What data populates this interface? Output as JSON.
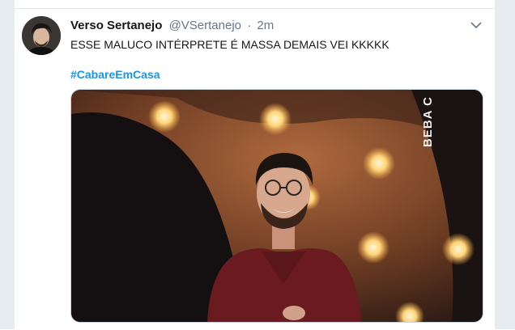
{
  "tweet": {
    "display_name": "Verso Sertanejo",
    "handle": "@VSertanejo",
    "separator": "·",
    "time": "2m",
    "text": "ESSE MALUCO INTÉRPRETE É MASSA DEMAIS VEI KKKKK",
    "hashtag": "#CabareEmCasa"
  },
  "media": {
    "overlay_text": "BEBA C"
  },
  "icons": {
    "menu": "chevron-down-icon"
  },
  "colors": {
    "background": "#e6ecf0",
    "name": "#14171a",
    "secondary": "#657786",
    "hashtag": "#1b95e0"
  }
}
